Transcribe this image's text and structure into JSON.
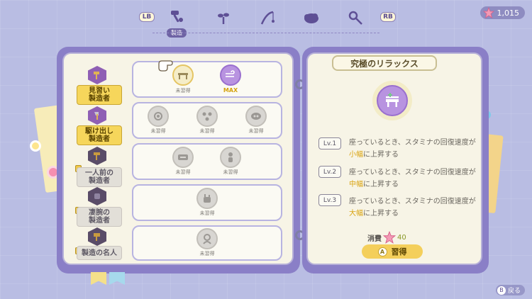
{
  "topbar": {
    "lb_label": "LB",
    "rb_label": "RB",
    "active_tab_label": "製造",
    "tabs": [
      {
        "icon": "hammer-icon"
      },
      {
        "icon": "sprout-icon"
      },
      {
        "icon": "fishing-rod-icon"
      },
      {
        "icon": "cloud-icon"
      },
      {
        "icon": "bug-net-icon"
      }
    ],
    "currency_value": "1,015"
  },
  "ranks": [
    {
      "label": "見習い\n製造者",
      "state": "active"
    },
    {
      "label": "駆け出し\n製造者",
      "state": "active"
    },
    {
      "label": "一人前の\n製造者",
      "state": "locked"
    },
    {
      "label": "凄腕の\n製造者",
      "state": "locked"
    },
    {
      "label": "製造の名人",
      "state": "locked"
    }
  ],
  "skill_rows": [
    {
      "skills": [
        {
          "status": "未習得",
          "icon": "bench-icon",
          "selected": true
        },
        {
          "status": "MAX",
          "icon": "wind-icon",
          "maxed": true
        }
      ]
    },
    {
      "skills": [
        {
          "status": "未習得",
          "icon": "gear-icon"
        },
        {
          "status": "未習得",
          "icon": "nodes-icon"
        },
        {
          "status": "未習得",
          "icon": "cloud-bubble-icon"
        }
      ]
    },
    {
      "skills": [
        {
          "status": "未習得",
          "icon": "box-icon"
        },
        {
          "status": "未習得",
          "icon": "figure-icon"
        }
      ]
    },
    {
      "skills": [
        {
          "status": "未習得",
          "icon": "wrench-icon"
        }
      ]
    },
    {
      "skills": [
        {
          "status": "未習得",
          "icon": "person-icon"
        }
      ]
    }
  ],
  "detail": {
    "title": "究極のリラックス",
    "levels": [
      {
        "label": "Lv.1",
        "pre": "座っているとき、スタミナの回復速度が",
        "hl": "小幅",
        "post": "に上昇する"
      },
      {
        "label": "Lv.2",
        "pre": "座っているとき、スタミナの回復速度が",
        "hl": "中幅",
        "post": "に上昇する"
      },
      {
        "label": "Lv.3",
        "pre": "座っているとき、スタミナの回復速度が",
        "hl": "大幅",
        "post": "に上昇する"
      }
    ],
    "cost_label": "消費",
    "cost_value": "40",
    "acquire_key": "A",
    "acquire_label": "習得"
  },
  "footer": {
    "back_key": "B",
    "back_label": "戻る"
  },
  "colors": {
    "accent": "#f4cf5b",
    "book": "#8a7fc7",
    "page": "#f7f4e6",
    "highlight": "#d9a412"
  }
}
